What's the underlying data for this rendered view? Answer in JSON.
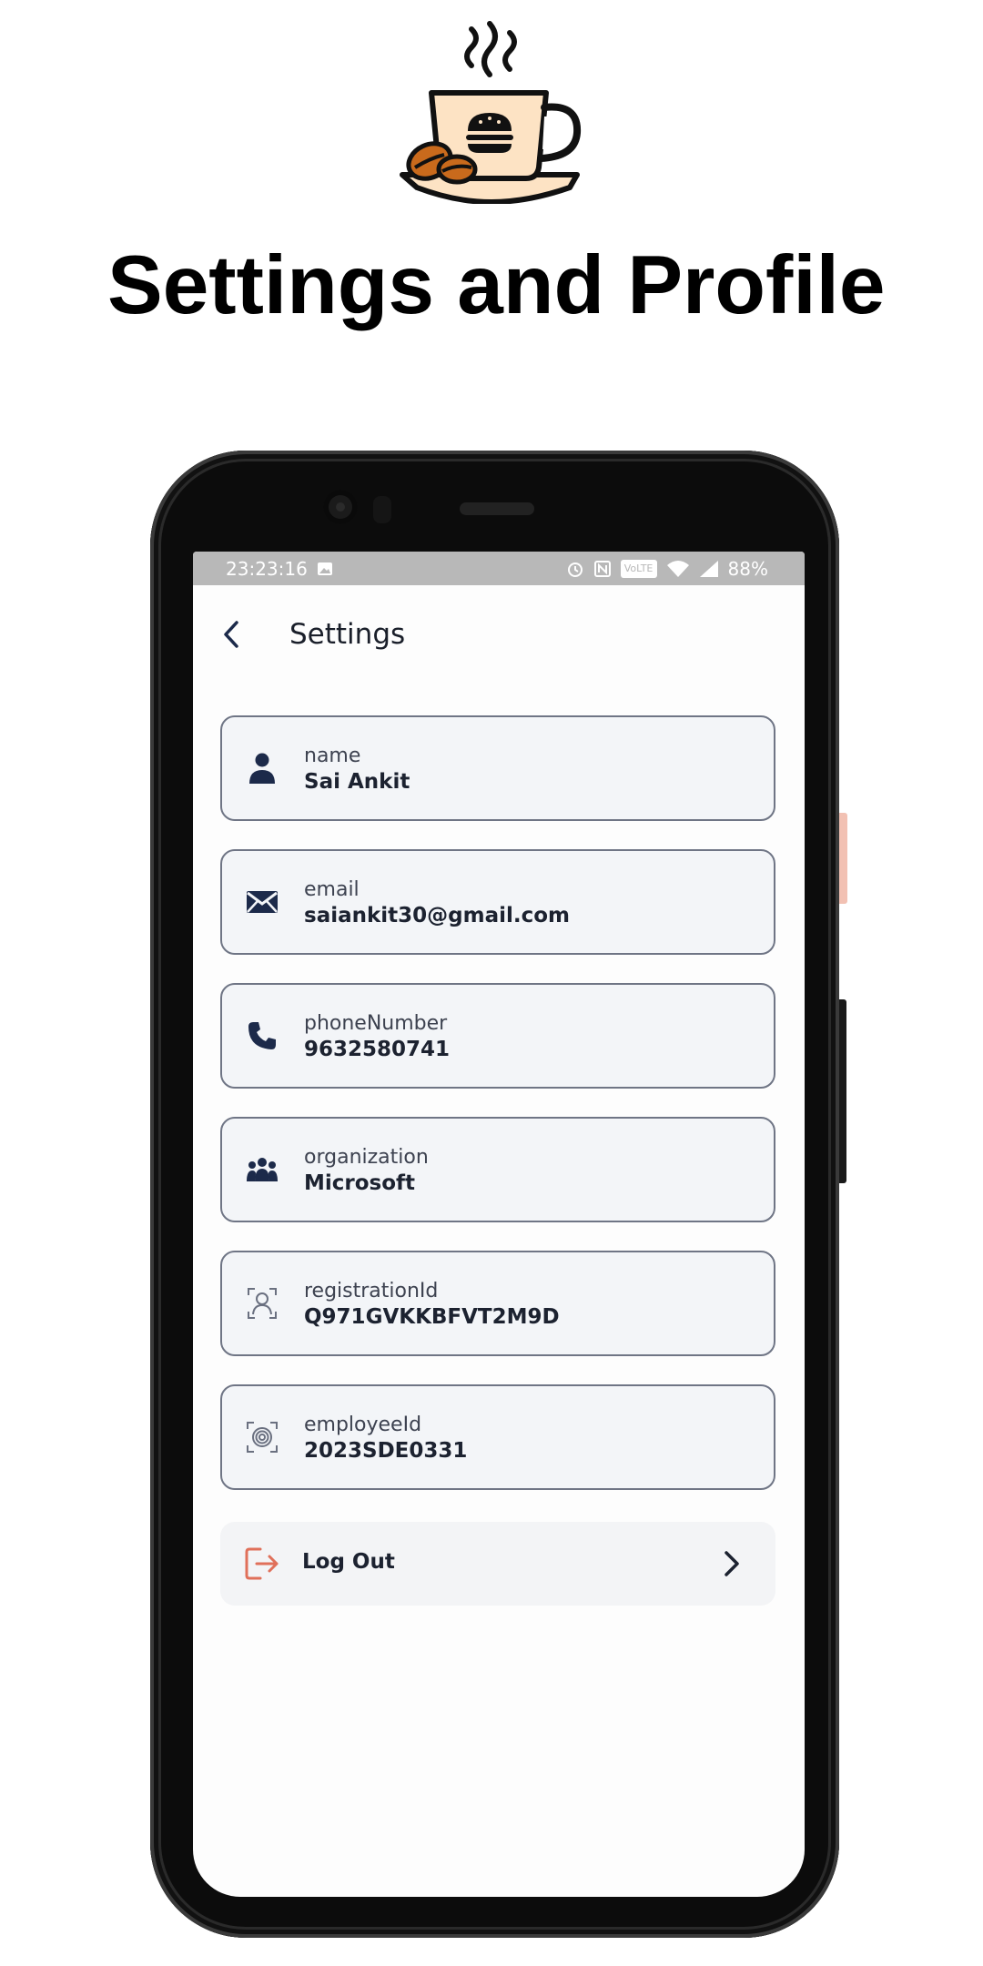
{
  "page": {
    "headline": "Settings and Profile",
    "logo_icon": "coffee-cup-burger-icon"
  },
  "status_bar": {
    "time": "23:23:16",
    "battery": "88%",
    "volte": "VoLTE",
    "icons": [
      "image-icon",
      "alarm-icon",
      "nfc-icon",
      "volte-icon",
      "wifi-icon",
      "signal-icon"
    ]
  },
  "app_bar": {
    "title": "Settings",
    "back_icon": "chevron-left-icon"
  },
  "profile_fields": [
    {
      "label": "name",
      "value": "Sai Ankit",
      "icon": "person-icon"
    },
    {
      "label": "email",
      "value": "saiankit30@gmail.com",
      "icon": "envelope-icon"
    },
    {
      "label": "phoneNumber",
      "value": "9632580741",
      "icon": "phone-icon"
    },
    {
      "label": "organization",
      "value": "Microsoft",
      "icon": "group-icon"
    },
    {
      "label": "registrationId",
      "value": "Q971GVKKBFVT2M9D",
      "icon": "face-id-icon"
    },
    {
      "label": "employeeId",
      "value": "2023SDE0331",
      "icon": "fingerprint-icon"
    }
  ],
  "logout": {
    "label": "Log Out",
    "icon": "logout-icon",
    "chevron": "chevron-right-icon"
  },
  "colors": {
    "navy": "#1c2a4a",
    "card_bg": "#f3f5f8",
    "card_border": "#6f7585",
    "logout_red": "#e0705a",
    "cup_fill": "#fde3c4",
    "bean": "#c96a1c"
  }
}
